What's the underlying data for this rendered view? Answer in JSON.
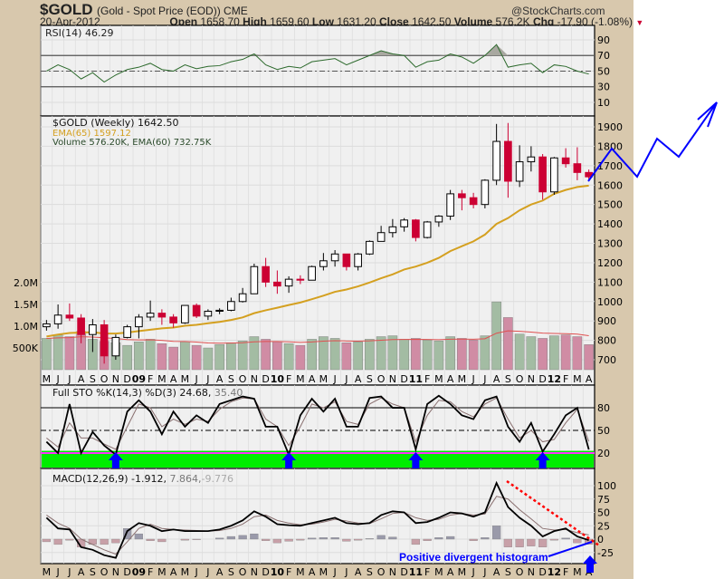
{
  "header": {
    "symbol": "$GOLD",
    "description": "(Gold - Spot Price (EOD))",
    "exchange": "CME",
    "watermark": "@StockCharts.com",
    "date": "20-Apr-2012",
    "open_label": "Open",
    "open": "1658.70",
    "high_label": "High",
    "high": "1659.60",
    "low_label": "Low",
    "low": "1631.20",
    "close_label": "Close",
    "close": "1642.50",
    "volume_label": "Volume",
    "volume": "576.2K",
    "chg_label": "Chg",
    "chg": "-17.90 (-1.08%)"
  },
  "legends": {
    "rsi": "RSI(14) 46.29",
    "price": "$GOLD (Weekly) 1642.50",
    "ema": "EMA(65) 1597.12",
    "volume": "Volume 576.20K, EMA(60) 732.75K",
    "sto": "Full STO %K(14,3) %D(3) 24.68,",
    "sto_d": "35.40",
    "macd": "MACD(12,26,9) -1.912,",
    "macd_signal": "7.864,",
    "macd_hist": "-9.776"
  },
  "annotation": "Positive divergent histogram",
  "colors": {
    "up": "#000000",
    "down": "#cc0033",
    "ema": "#d4a020",
    "vol_up": "#a3bca3",
    "vol_down": "#d08ca4",
    "band": "#00ee00",
    "band_line": "#ff33ff",
    "arrow": "#0000ff"
  },
  "chart_data": {
    "type": "candlestick",
    "title": "$GOLD (Weekly)",
    "months": [
      "M",
      "J",
      "J",
      "A",
      "S",
      "O",
      "N",
      "D",
      "09",
      "F",
      "M",
      "A",
      "M",
      "J",
      "J",
      "A",
      "S",
      "O",
      "N",
      "D",
      "10",
      "F",
      "M",
      "A",
      "M",
      "J",
      "J",
      "A",
      "S",
      "O",
      "N",
      "D",
      "11",
      "F",
      "M",
      "A",
      "M",
      "J",
      "J",
      "A",
      "S",
      "O",
      "N",
      "D",
      "12",
      "F",
      "M",
      "A"
    ],
    "price_ticks": [
      1900,
      1800,
      1700,
      1600,
      1500,
      1400,
      1300,
      1200,
      1100,
      1000,
      900,
      800,
      700
    ],
    "volume_ticks": [
      "2.0M",
      "1.5M",
      "1.0M",
      "500K"
    ],
    "volume_tick_values": [
      2000,
      1500,
      1000,
      500
    ],
    "rsi_ticks": [
      90,
      70,
      50,
      30,
      10
    ],
    "sto_ticks": [
      80,
      50,
      20
    ],
    "macd_ticks": [
      100,
      75,
      50,
      25,
      0,
      -25
    ],
    "close": [
      885,
      930,
      915,
      830,
      880,
      720,
      815,
      870,
      920,
      940,
      920,
      890,
      980,
      925,
      950,
      955,
      1000,
      1040,
      1180,
      1100,
      1080,
      1115,
      1110,
      1180,
      1210,
      1245,
      1180,
      1245,
      1310,
      1355,
      1385,
      1420,
      1330,
      1410,
      1440,
      1555,
      1535,
      1500,
      1625,
      1825,
      1620,
      1720,
      1745,
      1565,
      1740,
      1710,
      1665,
      1642.5
    ],
    "high": [
      905,
      985,
      990,
      935,
      910,
      905,
      830,
      880,
      935,
      1005,
      960,
      935,
      980,
      990,
      960,
      965,
      1020,
      1070,
      1195,
      1225,
      1160,
      1130,
      1135,
      1185,
      1250,
      1265,
      1245,
      1250,
      1315,
      1390,
      1425,
      1430,
      1425,
      1415,
      1445,
      1575,
      1575,
      1560,
      1630,
      1915,
      1920,
      1805,
      1800,
      1760,
      1745,
      1790,
      1795,
      1680
    ],
    "low": [
      850,
      860,
      900,
      785,
      740,
      680,
      700,
      810,
      810,
      900,
      880,
      865,
      885,
      915,
      905,
      935,
      950,
      995,
      1040,
      1075,
      1040,
      1045,
      1090,
      1110,
      1160,
      1180,
      1160,
      1160,
      1240,
      1310,
      1330,
      1360,
      1310,
      1325,
      1385,
      1420,
      1470,
      1480,
      1480,
      1600,
      1535,
      1590,
      1670,
      1525,
      1550,
      1690,
      1625,
      1630
    ],
    "first_open": 870,
    "ema65": [
      820,
      830,
      838,
      840,
      842,
      835,
      835,
      840,
      848,
      855,
      862,
      866,
      875,
      880,
      888,
      895,
      905,
      918,
      940,
      955,
      968,
      982,
      995,
      1012,
      1030,
      1050,
      1062,
      1078,
      1098,
      1120,
      1140,
      1165,
      1180,
      1200,
      1225,
      1260,
      1285,
      1310,
      1345,
      1400,
      1430,
      1470,
      1500,
      1520,
      1555,
      1575,
      1590,
      1597.12
    ],
    "volume_k": [
      720,
      800,
      760,
      880,
      700,
      650,
      620,
      560,
      640,
      700,
      600,
      520,
      640,
      560,
      500,
      580,
      620,
      660,
      760,
      700,
      640,
      600,
      560,
      700,
      760,
      720,
      620,
      640,
      700,
      760,
      780,
      700,
      720,
      680,
      660,
      760,
      720,
      680,
      780,
      1560,
      1200,
      820,
      760,
      720,
      780,
      800,
      760,
      576.2
    ],
    "rsi": [
      50,
      58,
      52,
      40,
      48,
      36,
      45,
      52,
      55,
      60,
      52,
      50,
      58,
      53,
      56,
      57,
      62,
      65,
      72,
      58,
      52,
      56,
      54,
      62,
      64,
      66,
      58,
      64,
      70,
      76,
      72,
      70,
      55,
      62,
      64,
      72,
      68,
      60,
      70,
      84,
      55,
      58,
      60,
      48,
      58,
      56,
      50,
      46.29
    ],
    "sto_k": [
      35,
      20,
      85,
      20,
      48,
      30,
      18,
      75,
      90,
      75,
      45,
      75,
      55,
      70,
      60,
      85,
      90,
      95,
      92,
      55,
      55,
      18,
      70,
      92,
      75,
      92,
      55,
      55,
      93,
      95,
      80,
      80,
      25,
      85,
      96,
      85,
      70,
      65,
      90,
      95,
      55,
      35,
      60,
      22,
      45,
      70,
      80,
      24.68
    ],
    "sto_d": [
      40,
      28,
      60,
      40,
      40,
      32,
      25,
      55,
      85,
      80,
      55,
      65,
      58,
      65,
      62,
      78,
      88,
      93,
      92,
      65,
      55,
      30,
      55,
      85,
      80,
      88,
      62,
      58,
      85,
      93,
      85,
      80,
      35,
      70,
      90,
      88,
      75,
      68,
      85,
      93,
      65,
      40,
      50,
      35,
      38,
      60,
      78,
      35.4
    ],
    "macd": [
      40,
      20,
      18,
      -15,
      -20,
      -30,
      -35,
      15,
      30,
      25,
      15,
      18,
      15,
      15,
      15,
      18,
      25,
      35,
      52,
      42,
      28,
      26,
      25,
      30,
      35,
      40,
      30,
      28,
      30,
      45,
      52,
      50,
      30,
      32,
      40,
      50,
      48,
      42,
      50,
      105,
      60,
      40,
      25,
      5,
      15,
      20,
      5,
      -1.912
    ],
    "signal": [
      45,
      30,
      20,
      0,
      -10,
      -20,
      -28,
      -5,
      20,
      28,
      20,
      18,
      17,
      16,
      15,
      16,
      20,
      28,
      42,
      45,
      35,
      30,
      27,
      28,
      32,
      37,
      34,
      30,
      29,
      38,
      48,
      50,
      40,
      35,
      37,
      45,
      48,
      45,
      47,
      80,
      75,
      55,
      38,
      20,
      17,
      18,
      12,
      7.864
    ],
    "sto_arrow_months": [
      6,
      21,
      32,
      43
    ],
    "xlabel": "",
    "ylabel": ""
  }
}
